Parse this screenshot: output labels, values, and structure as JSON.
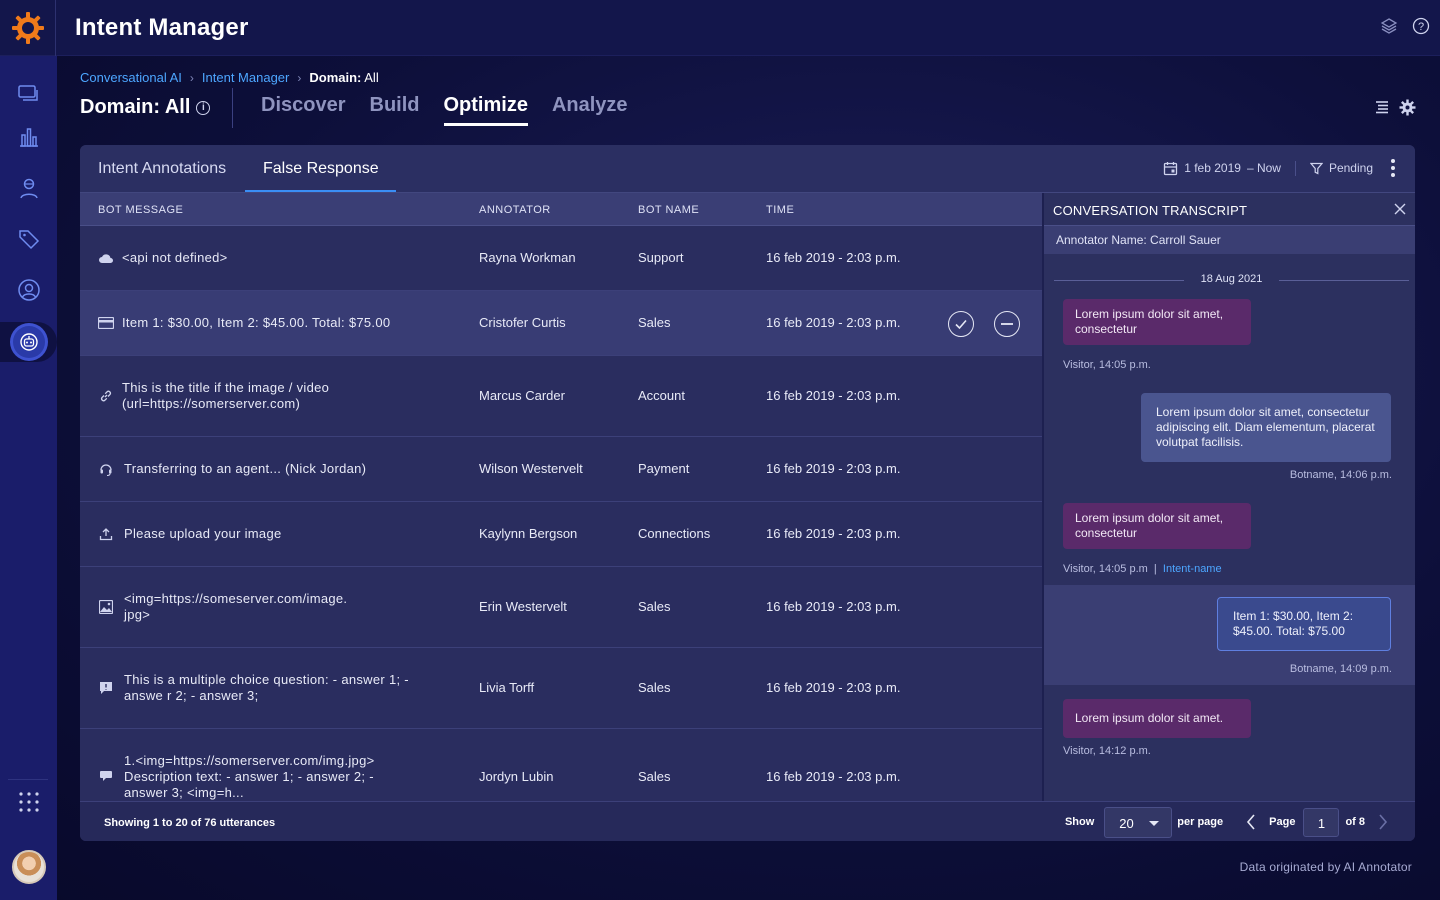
{
  "app": {
    "title": "Intent Manager"
  },
  "breadcrumb": {
    "items": [
      "Conversational AI",
      "Intent Manager"
    ],
    "current_prefix": "Domain:",
    "current_value": "All"
  },
  "header": {
    "domain_title": "Domain: All",
    "info_glyph": "i"
  },
  "main_tabs": [
    {
      "label": "Discover",
      "active": false
    },
    {
      "label": "Build",
      "active": false
    },
    {
      "label": "Optimize",
      "active": true
    },
    {
      "label": "Analyze",
      "active": false
    }
  ],
  "sub_tabs": [
    {
      "label": "Intent Annotations",
      "active": false
    },
    {
      "label": "False Response",
      "active": true
    }
  ],
  "filters": {
    "date_from": "1 feb 2019",
    "date_to": "– Now",
    "status": "Pending"
  },
  "table": {
    "columns": [
      "BOT MESSAGE",
      "ANNOTATOR",
      "BOT NAME",
      "TIME"
    ],
    "rows": [
      {
        "icon": "cloud-icon",
        "message": "<api not defined>",
        "annotator": "Rayna Workman",
        "bot": "Support",
        "time": "16 feb 2019 - 2:03 p.m."
      },
      {
        "icon": "card-icon",
        "message": "Item 1: $30.00, Item 2: $45.00. Total: $75.00",
        "annotator": "Cristofer Curtis",
        "bot": "Sales",
        "time": "16 feb 2019 - 2:03 p.m."
      },
      {
        "icon": "link-icon",
        "message": "This is the title if the image / video (url=https://somerserver.com)",
        "annotator": "Marcus Carder",
        "bot": "Account",
        "time": "16 feb 2019 - 2:03 p.m."
      },
      {
        "icon": "headset-icon",
        "message": "Transferring to an agent... (Nick Jordan)",
        "annotator": "Wilson Westervelt",
        "bot": "Payment",
        "time": "16 feb 2019 - 2:03 p.m."
      },
      {
        "icon": "upload-icon",
        "message": "Please upload your image",
        "annotator": "Kaylynn Bergson",
        "bot": "Connections",
        "time": "16 feb 2019 - 2:03 p.m."
      },
      {
        "icon": "image-icon",
        "message": "<img=https://someserver.com/image.jpg>",
        "annotator": "Erin Westervelt",
        "bot": "Sales",
        "time": "16 feb 2019 - 2:03 p.m."
      },
      {
        "icon": "quick-reply-icon",
        "message": "This is a multiple choice question: - answer 1; - answe r 2; - answer 3;",
        "annotator": "Livia Torff",
        "bot": "Sales",
        "time": "16 feb 2019 - 2:03 p.m."
      },
      {
        "icon": "carousel-icon",
        "message": "1.<img=https://somerserver.com/img.jpg> Description text: - answer 1; - answer 2; - answer 3;  <img=h...",
        "annotator": "Jordyn Lubin",
        "bot": "Sales",
        "time": "16 feb 2019 - 2:03 p.m."
      }
    ]
  },
  "transcript": {
    "title": "CONVERSATION TRANSCRIPT",
    "annotator_name": "Annotator Name: Carroll Sauer",
    "date": "18 Aug 2021",
    "messages": [
      {
        "from": "visitor",
        "text": "Lorem ipsum dolor sit amet, consectetur",
        "meta": "Visitor, 14:05 p.m."
      },
      {
        "from": "bot",
        "text": "Lorem ipsum dolor sit amet, consectetur adipiscing elit. Diam elementum, placerat volutpat facilisis.",
        "meta": "Botname, 14:06 p.m."
      },
      {
        "from": "visitor",
        "text": "Lorem ipsum dolor sit amet, consectetur",
        "meta": "Visitor, 14:05 p.m",
        "intent": "Intent-name"
      },
      {
        "from": "bot",
        "text": "Item 1: $30.00, Item 2: $45.00. Total: $75.00",
        "meta": "Botname, 14:09 p.m."
      },
      {
        "from": "visitor",
        "text": "Lorem ipsum dolor sit amet.",
        "meta": "Visitor, 14:12 p.m."
      }
    ]
  },
  "footer": {
    "showing": "Showing 1 to 20 of 76 utterances",
    "show_label": "Show",
    "per_page_value": "20",
    "per_page_label": "per page",
    "page_label": "Page",
    "page_value": "1",
    "of_label": "of 8"
  },
  "data_origin": "Data originated by AI Annotator",
  "colors": {
    "accent": "#3a8ef5",
    "link": "#4da6ff",
    "visitor_bubble": "#5a2a6a",
    "bot_bubble": "#4a558f",
    "rail": "#1a1d6a",
    "logo": "#f07a1a"
  }
}
